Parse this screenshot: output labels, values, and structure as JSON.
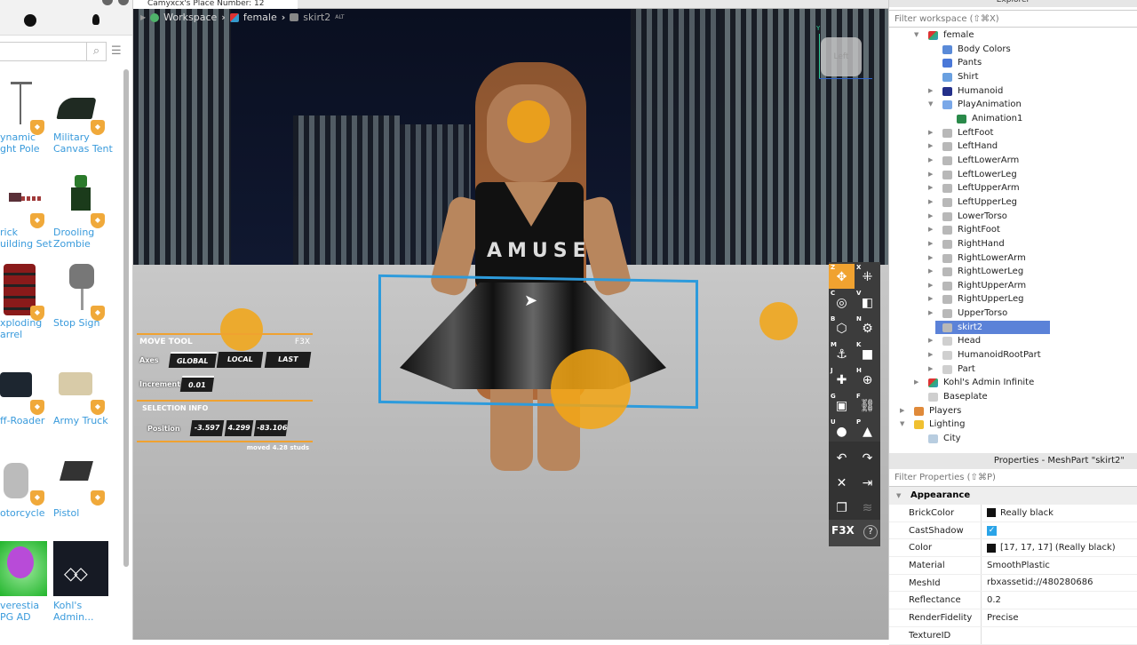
{
  "window": {
    "tab_title": "Camyxcx's Place Number: 12"
  },
  "toolbox": {
    "search_placeholder": "",
    "items": [
      {
        "label": "Dynamic Light Pole",
        "l1": "ynamic",
        "l2": "ght Pole"
      },
      {
        "label": "Military Canvas Tent",
        "l1": "Military",
        "l2": "Canvas Tent"
      },
      {
        "label": "Brick Building Set",
        "l1": "rick",
        "l2": "uilding Set"
      },
      {
        "label": "Drooling Zombie",
        "l1": "Drooling",
        "l2": "Zombie"
      },
      {
        "label": "Exploding Barrel",
        "l1": "xploding",
        "l2": "arrel"
      },
      {
        "label": "Stop Sign",
        "l1": "Stop Sign",
        "l2": ""
      },
      {
        "label": "Off-Roader",
        "l1": "ff-Roader",
        "l2": ""
      },
      {
        "label": "Army Truck",
        "l1": "Army Truck",
        "l2": ""
      },
      {
        "label": "Motorcycle",
        "l1": "otorcycle",
        "l2": ""
      },
      {
        "label": "Pistol",
        "l1": "Pistol",
        "l2": ""
      },
      {
        "label": "Everestia RPG AD",
        "l1": "verestia",
        "l2": "PG AD"
      },
      {
        "label": "Kohl's Admin...",
        "l1": "Kohl's",
        "l2": "Admin..."
      }
    ],
    "badge_icon": "verified-shield-icon"
  },
  "breadcrumb": {
    "items": [
      "Workspace",
      "female",
      "skirt2"
    ],
    "suffix": "ALT"
  },
  "viewcube": {
    "face": "Left",
    "axis_label": "Y"
  },
  "shirt_text": "AMUSE",
  "move_tool": {
    "title": "MOVE TOOL",
    "brand": "F3X",
    "axes_label": "Axes",
    "axes_options": [
      "GLOBAL",
      "LOCAL",
      "LAST"
    ],
    "axes_selected": "GLOBAL",
    "increment_label": "Increment",
    "increment_value": "0.01",
    "selection_info_label": "SELECTION INFO",
    "position_label": "Position",
    "position": [
      "-3.597",
      "4.299",
      "-83.106"
    ],
    "moved_text": "moved 4.28 studs"
  },
  "f3x_tools": [
    {
      "key": "Z",
      "icon": "move-icon",
      "glyph": "✥",
      "selected": true
    },
    {
      "key": "X",
      "icon": "resize-icon",
      "glyph": "⁜"
    },
    {
      "key": "C",
      "icon": "rotate-icon",
      "glyph": "◎"
    },
    {
      "key": "V",
      "icon": "paint-bucket-icon",
      "glyph": "◧"
    },
    {
      "key": "B",
      "icon": "surface-icon",
      "glyph": "⬡"
    },
    {
      "key": "N",
      "icon": "material-gear-icon",
      "glyph": "⚙"
    },
    {
      "key": "M",
      "icon": "anchor-icon",
      "glyph": "⚓"
    },
    {
      "key": "K",
      "icon": "collision-icon",
      "glyph": "■"
    },
    {
      "key": "J",
      "icon": "new-part-icon",
      "glyph": "✚"
    },
    {
      "key": "H",
      "icon": "mesh-icon",
      "glyph": "⊕"
    },
    {
      "key": "G",
      "icon": "texture-icon",
      "glyph": "▣"
    },
    {
      "key": "F",
      "icon": "weld-link-icon",
      "glyph": "⛓"
    },
    {
      "key": "U",
      "icon": "lighting-bulb-icon",
      "glyph": "●"
    },
    {
      "key": "P",
      "icon": "decorate-icon",
      "glyph": "▲"
    }
  ],
  "f3x_actions": [
    {
      "icon": "undo-icon",
      "glyph": "↶"
    },
    {
      "icon": "redo-icon",
      "glyph": "↷"
    },
    {
      "icon": "delete-icon",
      "glyph": "✕"
    },
    {
      "icon": "export-icon",
      "glyph": "⇥"
    },
    {
      "icon": "clone-icon",
      "glyph": "❐"
    },
    {
      "icon": "layers-icon",
      "glyph": "≋"
    }
  ],
  "f3x_footer": {
    "brand": "F3X",
    "help": "?"
  },
  "explorer": {
    "title": "Explorer",
    "filter_placeholder": "Filter workspace (⇧⌘X)",
    "nodes": [
      {
        "name": "female",
        "depth": 2,
        "arrow": "▼",
        "icon": "model"
      },
      {
        "name": "Body Colors",
        "depth": 3,
        "arrow": "",
        "icon": "bodycolors"
      },
      {
        "name": "Pants",
        "depth": 3,
        "arrow": "",
        "icon": "pants"
      },
      {
        "name": "Shirt",
        "depth": 3,
        "arrow": "",
        "icon": "shirt"
      },
      {
        "name": "Humanoid",
        "depth": 3,
        "arrow": "▶",
        "icon": "humanoid"
      },
      {
        "name": "PlayAnimation",
        "depth": 3,
        "arrow": "▼",
        "icon": "script"
      },
      {
        "name": "Animation1",
        "depth": 4,
        "arrow": "",
        "icon": "animation"
      },
      {
        "name": "LeftFoot",
        "depth": 3,
        "arrow": "▶",
        "icon": "mesh"
      },
      {
        "name": "LeftHand",
        "depth": 3,
        "arrow": "▶",
        "icon": "mesh"
      },
      {
        "name": "LeftLowerArm",
        "depth": 3,
        "arrow": "▶",
        "icon": "mesh"
      },
      {
        "name": "LeftLowerLeg",
        "depth": 3,
        "arrow": "▶",
        "icon": "mesh"
      },
      {
        "name": "LeftUpperArm",
        "depth": 3,
        "arrow": "▶",
        "icon": "mesh"
      },
      {
        "name": "LeftUpperLeg",
        "depth": 3,
        "arrow": "▶",
        "icon": "mesh"
      },
      {
        "name": "LowerTorso",
        "depth": 3,
        "arrow": "▶",
        "icon": "mesh"
      },
      {
        "name": "RightFoot",
        "depth": 3,
        "arrow": "▶",
        "icon": "mesh"
      },
      {
        "name": "RightHand",
        "depth": 3,
        "arrow": "▶",
        "icon": "mesh"
      },
      {
        "name": "RightLowerArm",
        "depth": 3,
        "arrow": "▶",
        "icon": "mesh"
      },
      {
        "name": "RightLowerLeg",
        "depth": 3,
        "arrow": "▶",
        "icon": "mesh"
      },
      {
        "name": "RightUpperArm",
        "depth": 3,
        "arrow": "▶",
        "icon": "mesh"
      },
      {
        "name": "RightUpperLeg",
        "depth": 3,
        "arrow": "▶",
        "icon": "mesh"
      },
      {
        "name": "UpperTorso",
        "depth": 3,
        "arrow": "▶",
        "icon": "mesh"
      },
      {
        "name": "skirt2",
        "depth": 3,
        "arrow": "",
        "icon": "mesh",
        "selected": true
      },
      {
        "name": "Head",
        "depth": 3,
        "arrow": "▶",
        "icon": "part"
      },
      {
        "name": "HumanoidRootPart",
        "depth": 3,
        "arrow": "▶",
        "icon": "part"
      },
      {
        "name": "Part",
        "depth": 3,
        "arrow": "▶",
        "icon": "part"
      },
      {
        "name": "Kohl's Admin Infinite",
        "depth": 2,
        "arrow": "▶",
        "icon": "model"
      },
      {
        "name": "Baseplate",
        "depth": 2,
        "arrow": "",
        "icon": "part"
      },
      {
        "name": "Players",
        "depth": 1,
        "arrow": "▶",
        "icon": "players"
      },
      {
        "name": "Lighting",
        "depth": 1,
        "arrow": "▼",
        "icon": "lighting"
      },
      {
        "name": "City",
        "depth": 2,
        "arrow": "",
        "icon": "sky"
      }
    ]
  },
  "properties": {
    "title": "Properties - MeshPart \"skirt2\"",
    "filter_placeholder": "Filter Properties (⇧⌘P)",
    "category": "Appearance",
    "rows": [
      {
        "key": "BrickColor",
        "value": "Really black",
        "swatch": "#111111"
      },
      {
        "key": "CastShadow",
        "value": "",
        "checkbox": true
      },
      {
        "key": "Color",
        "value": "[17, 17, 17] (Really black)",
        "swatch": "#111111"
      },
      {
        "key": "Material",
        "value": "SmoothPlastic"
      },
      {
        "key": "MeshId",
        "value": "rbxassetid://480280686"
      },
      {
        "key": "Reflectance",
        "value": "0.2"
      },
      {
        "key": "RenderFidelity",
        "value": "Precise"
      },
      {
        "key": "TextureID",
        "value": ""
      }
    ]
  },
  "colors": {
    "accent": "#f0a230",
    "selection": "#2d9bdc",
    "tree_selection": "#5b82d8",
    "link": "#3a9bdc"
  }
}
